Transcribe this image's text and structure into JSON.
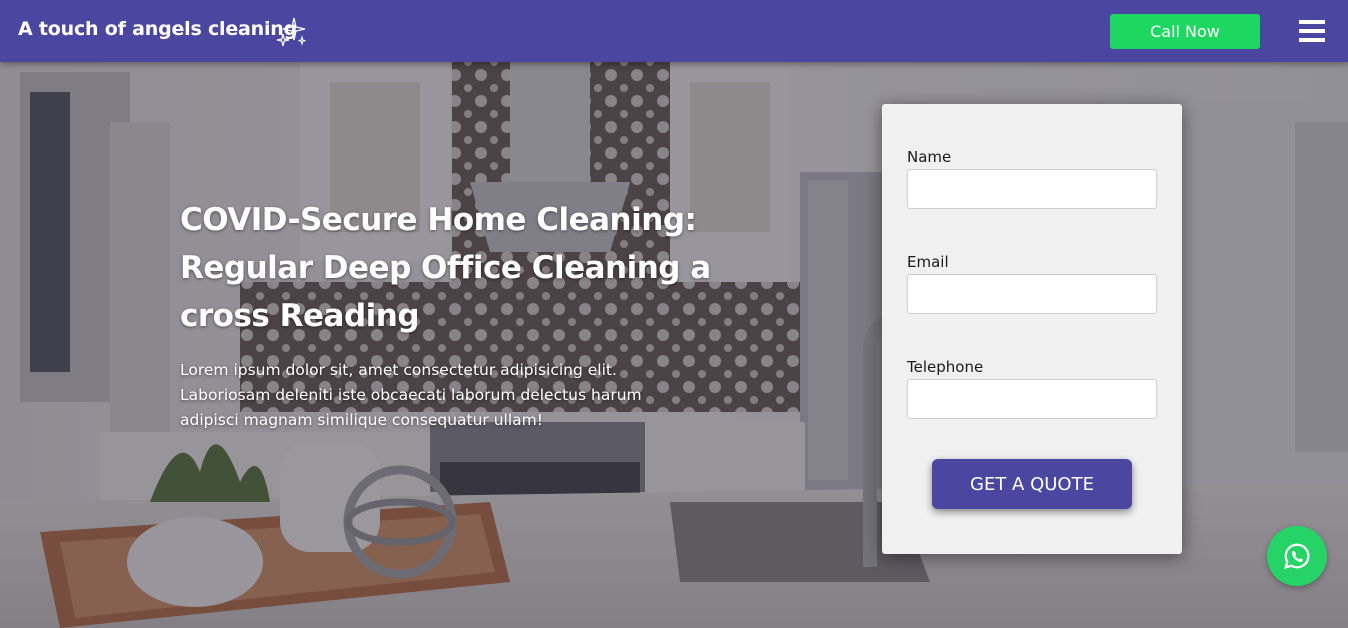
{
  "navbar": {
    "brand": "A touch of angels cleaning",
    "brand_icon": "sparkles-icon",
    "call_label": "Call Now",
    "menu_icon": "hamburger-menu-icon",
    "colors": {
      "bar": "#4b46a0",
      "call_button": "#1ed760"
    }
  },
  "hero": {
    "title": "COVID-Secure Home Cleaning: Regular Deep Office Cleaning a cross Reading",
    "text": "Lorem ipsum dolor sit, amet consectetur adipisicing elit. Laboriosam deleniti iste obcaecati laborum delectus harum adipisci magnam similique consequatur ullam!"
  },
  "form": {
    "fields": [
      {
        "label": "Name",
        "value": "",
        "placeholder": ""
      },
      {
        "label": "Email",
        "value": "",
        "placeholder": ""
      },
      {
        "label": "Telephone",
        "value": "",
        "placeholder": ""
      }
    ],
    "submit_label": "GET A QUOTE",
    "colors": {
      "card": "#f0f0f0",
      "button": "#4b46a0"
    }
  },
  "floating": {
    "icon": "whatsapp-icon",
    "color": "#25d366"
  }
}
